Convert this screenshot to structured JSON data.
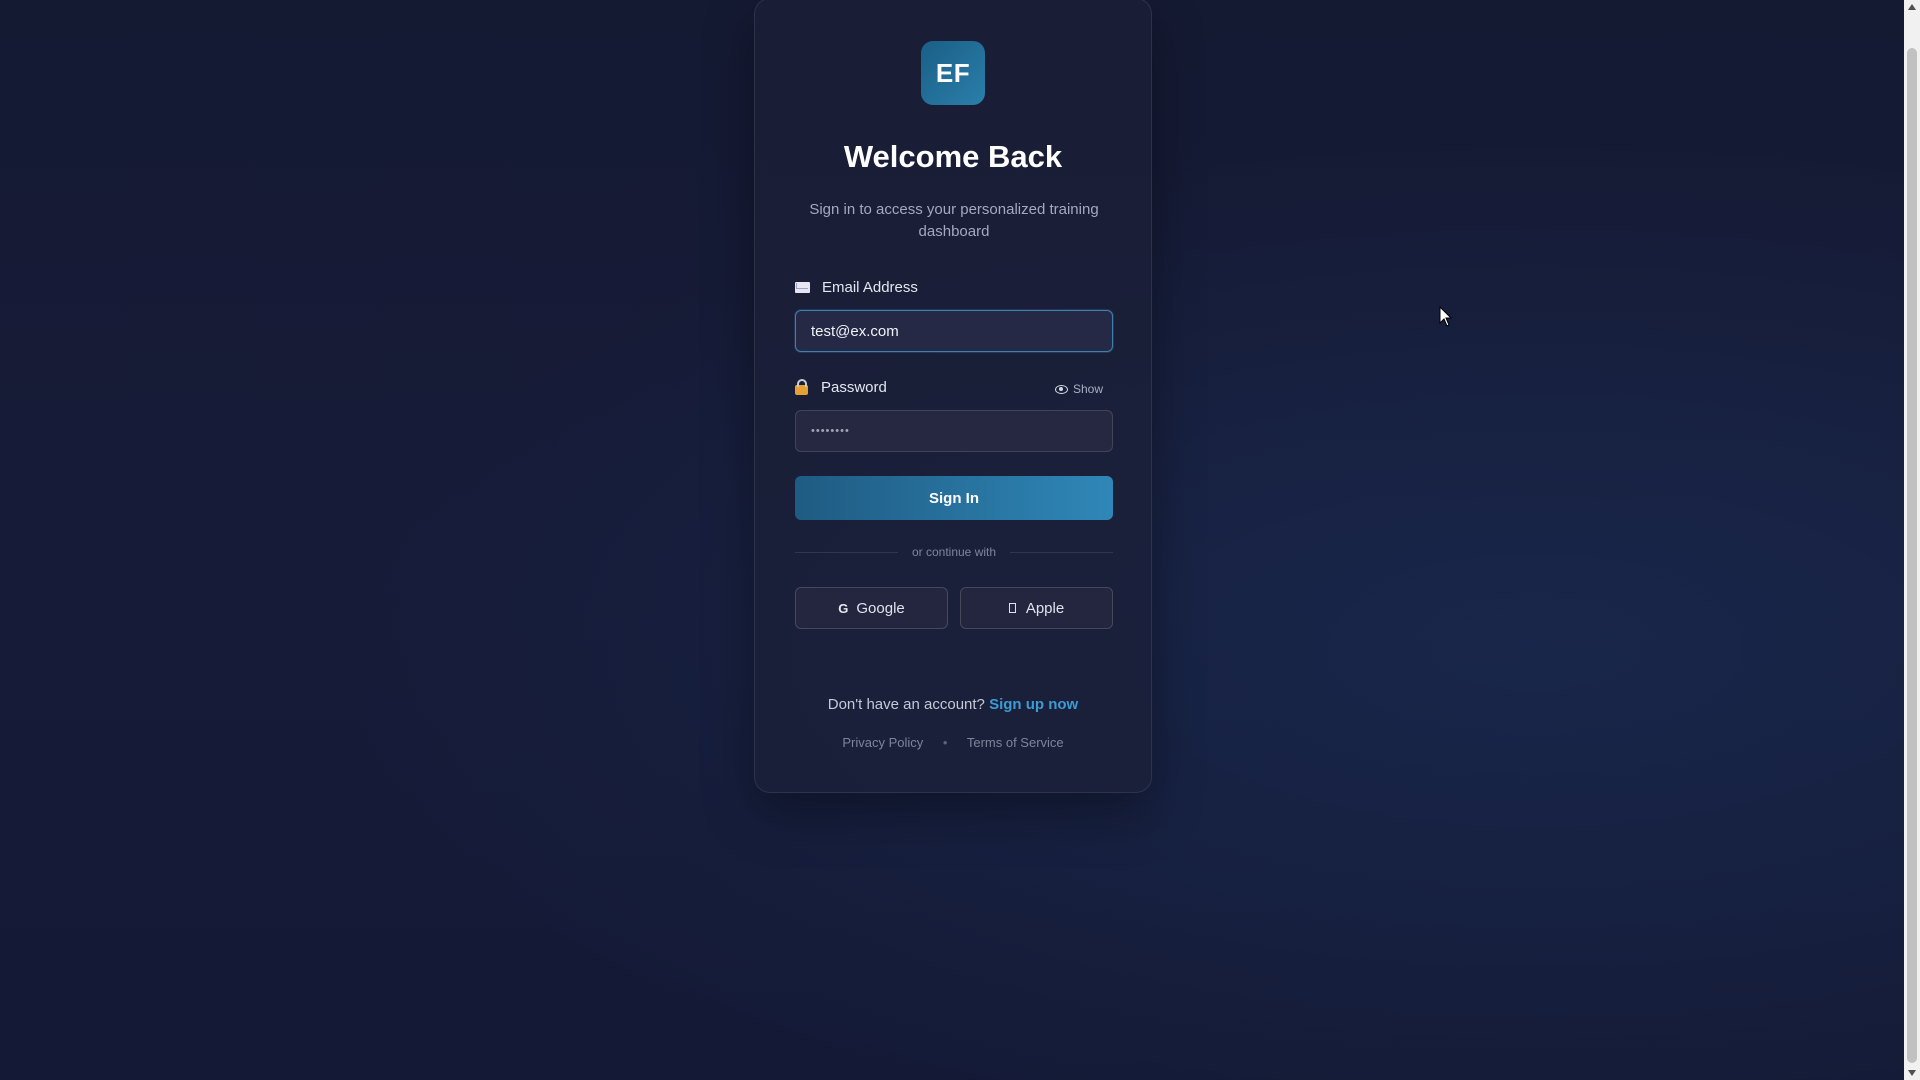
{
  "brand": {
    "logo_text": "EF",
    "logo_gradient": [
      "#1a5f86",
      "#2a7fab"
    ]
  },
  "header": {
    "title": "Welcome Back",
    "subtitle": "Sign in to access your personalized training dashboard"
  },
  "form": {
    "email": {
      "label": "Email Address",
      "icon": "envelope-icon",
      "value": "test@ex.com"
    },
    "password": {
      "label": "Password",
      "icon": "lock-icon",
      "masked_value": "••••••••",
      "toggle_label": "Show",
      "toggle_icon": "eye-icon"
    },
    "submit_label": "Sign In"
  },
  "social": {
    "divider_text": "or continue with",
    "google_label": "Google",
    "google_icon_text": "G",
    "apple_label": "Apple"
  },
  "signup": {
    "prompt": "Don't have an account?",
    "link_label": "Sign up now"
  },
  "footer": {
    "privacy_label": "Privacy Policy",
    "separator": "•",
    "terms_label": "Terms of Service"
  },
  "colors": {
    "accent": "#2f87b8",
    "link": "#3d9bd4",
    "background": "#161b38"
  }
}
